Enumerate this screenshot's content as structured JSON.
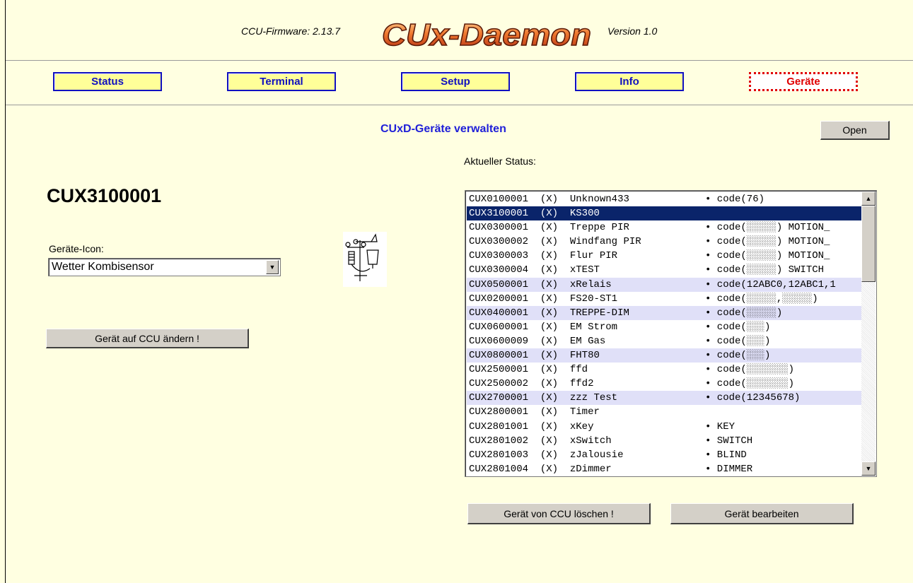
{
  "header": {
    "firmware_label": "CCU-Firmware: 2.13.7",
    "logo_text": "CUx-Daemon",
    "version_label": "Version 1.0"
  },
  "nav": {
    "items": [
      {
        "label": "Status"
      },
      {
        "label": "Terminal"
      },
      {
        "label": "Setup"
      },
      {
        "label": "Info"
      },
      {
        "label": "Geräte",
        "active": true
      }
    ]
  },
  "main": {
    "title": "CUxD-Geräte verwalten",
    "open_button": "Open",
    "status_label": "Aktueller Status:"
  },
  "device": {
    "id": "CUX3100001",
    "icon_label": "Geräte-Icon:",
    "icon_select_value": "Wetter Kombisensor",
    "change_button": "Gerät auf CCU ändern !"
  },
  "device_list": {
    "rows": [
      {
        "id": "CUX0100001",
        "flag": "(X)",
        "name": "Unknown433",
        "info": "• code(76)",
        "style": "normal"
      },
      {
        "id": "CUX3100001",
        "flag": "(X)",
        "name": "KS300",
        "info": "",
        "style": "selected"
      },
      {
        "id": "CUX0300001",
        "flag": "(X)",
        "name": "Treppe PIR",
        "info": "• code(░░░░░) MOTION_",
        "style": "normal"
      },
      {
        "id": "CUX0300002",
        "flag": "(X)",
        "name": "Windfang PIR",
        "info": "• code(░░░░░) MOTION_",
        "style": "normal"
      },
      {
        "id": "CUX0300003",
        "flag": "(X)",
        "name": "Flur PIR",
        "info": "• code(░░░░░) MOTION_",
        "style": "normal"
      },
      {
        "id": "CUX0300004",
        "flag": "(X)",
        "name": "xTEST",
        "info": "• code(░░░░░) SWITCH",
        "style": "normal"
      },
      {
        "id": "CUX0500001",
        "flag": "(X)",
        "name": "xRelais",
        "info": "• code(12ABC0,12ABC1,1",
        "style": "alt"
      },
      {
        "id": "CUX0200001",
        "flag": "(X)",
        "name": "FS20-ST1",
        "info": "• code(░░░░░,░░░░░)",
        "style": "normal"
      },
      {
        "id": "CUX0400001",
        "flag": "(X)",
        "name": "TREPPE-DIM",
        "info": "• code(░░░░░)",
        "style": "alt"
      },
      {
        "id": "CUX0600001",
        "flag": "(X)",
        "name": "EM Strom",
        "info": "• code(░░░)",
        "style": "normal"
      },
      {
        "id": "CUX0600009",
        "flag": "(X)",
        "name": "EM Gas",
        "info": "• code(░░░)",
        "style": "normal"
      },
      {
        "id": "CUX0800001",
        "flag": "(X)",
        "name": "FHT80",
        "info": "• code(░░░)",
        "style": "alt"
      },
      {
        "id": "CUX2500001",
        "flag": "(X)",
        "name": "ffd",
        "info": "• code(░░░░░░░)",
        "style": "normal"
      },
      {
        "id": "CUX2500002",
        "flag": "(X)",
        "name": "ffd2",
        "info": "• code(░░░░░░░)",
        "style": "normal"
      },
      {
        "id": "CUX2700001",
        "flag": "(X)",
        "name": "zzz Test",
        "info": "• code(12345678)",
        "style": "alt"
      },
      {
        "id": "CUX2800001",
        "flag": "(X)",
        "name": "Timer",
        "info": "",
        "style": "normal"
      },
      {
        "id": "CUX2801001",
        "flag": "(X)",
        "name": "xKey",
        "info": "• KEY",
        "style": "normal"
      },
      {
        "id": "CUX2801002",
        "flag": "(X)",
        "name": "xSwitch",
        "info": "• SWITCH",
        "style": "normal"
      },
      {
        "id": "CUX2801003",
        "flag": "(X)",
        "name": "zJalousie",
        "info": "• BLIND",
        "style": "normal"
      },
      {
        "id": "CUX2801004",
        "flag": "(X)",
        "name": "zDimmer",
        "info": "• DIMMER",
        "style": "normal"
      }
    ]
  },
  "actions": {
    "delete_button": "Gerät von CCU löschen !",
    "edit_button": "Gerät bearbeiten"
  },
  "colors": {
    "background": "#FFFFE1",
    "nav_button_bg": "#FFFF99",
    "nav_button_text": "#1010C0",
    "active_tab": "#E00000",
    "selected_row": "#0A246A",
    "alt_row": "#E0E0F8",
    "title": "#2020D8"
  }
}
